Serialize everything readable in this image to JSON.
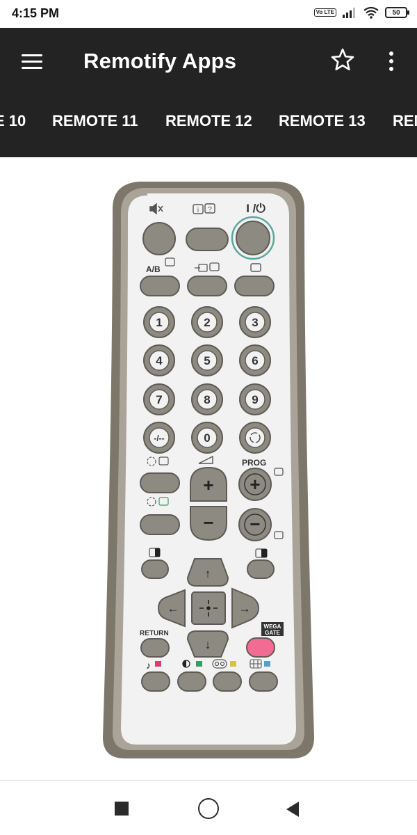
{
  "status_bar": {
    "time": "4:15 PM",
    "volte": "Vo LTE",
    "battery": "50",
    "icons": [
      "signal-icon",
      "wifi-icon",
      "battery-icon"
    ]
  },
  "app_bar": {
    "title": "Remotify Apps",
    "icons": [
      "menu-icon",
      "star-icon",
      "more-vert-icon"
    ]
  },
  "tabs": [
    {
      "label": "E 10"
    },
    {
      "label": "REMOTE 11"
    },
    {
      "label": "REMOTE 12"
    },
    {
      "label": "REMOTE 13"
    },
    {
      "label": "REM"
    }
  ],
  "remote": {
    "power_label": "I /⏻",
    "ab_label": "A/B",
    "digits": [
      "1",
      "2",
      "3",
      "4",
      "5",
      "6",
      "7",
      "8",
      "9"
    ],
    "dash_label": "-/--",
    "zero_label": "0",
    "prog_label": "PROG",
    "plus_symbol": "+",
    "minus_symbol": "−",
    "return_label": "RETURN",
    "wega_line1": "WEGA",
    "wega_line2": "GATE",
    "arrow_up": "↑",
    "arrow_down": "↓",
    "arrow_left": "←",
    "arrow_right": "→",
    "music_symbol": "♪",
    "colors": {
      "body_outer": "#7d776b",
      "body_inner": "#f2f2f3",
      "button": "#8d8a82",
      "power_ring": "#5aa89a",
      "wega": "#f26b92",
      "red": "#e23a6c",
      "green": "#3a9c62",
      "yellow": "#d7c43a",
      "blue": "#5a9ec6"
    }
  },
  "nav_bar": {
    "icons": [
      "recents-square-icon",
      "home-circle-icon",
      "back-triangle-icon"
    ]
  }
}
